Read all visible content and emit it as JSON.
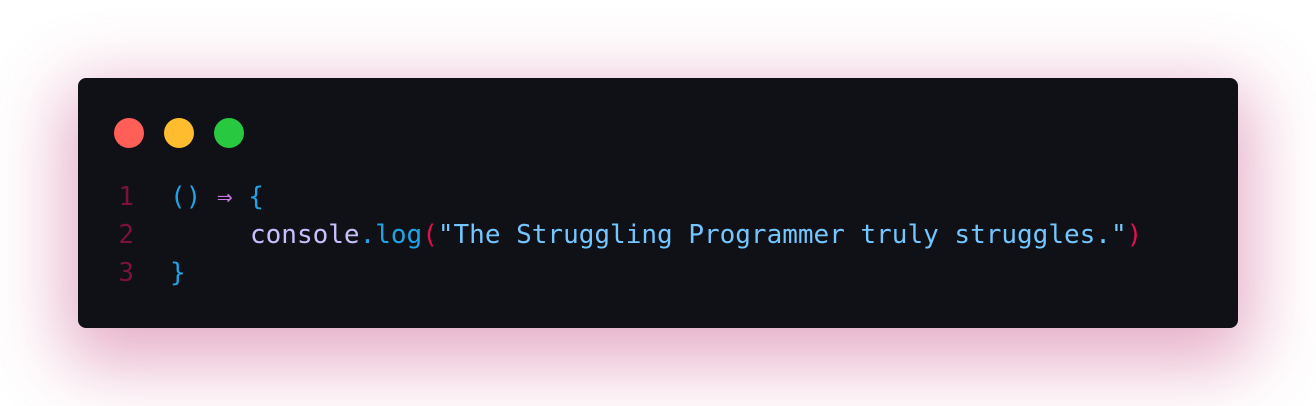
{
  "window": {
    "controls": [
      {
        "name": "close",
        "color": "#ff5f57"
      },
      {
        "name": "minimize",
        "color": "#febc2e"
      },
      {
        "name": "maximize",
        "color": "#28c840"
      }
    ]
  },
  "code": {
    "lines": [
      {
        "number": "1",
        "tokens": {
          "params": "()",
          "space1": " ",
          "arrow": "⇒",
          "space2": " ",
          "brace_open": "{"
        }
      },
      {
        "number": "2",
        "tokens": {
          "object": "console",
          "dot": ".",
          "method": "log",
          "paren_open": "(",
          "string": "\"The Struggling Programmer truly struggles.\"",
          "paren_close": ")"
        }
      },
      {
        "number": "3",
        "tokens": {
          "brace_close": "}"
        }
      }
    ]
  }
}
